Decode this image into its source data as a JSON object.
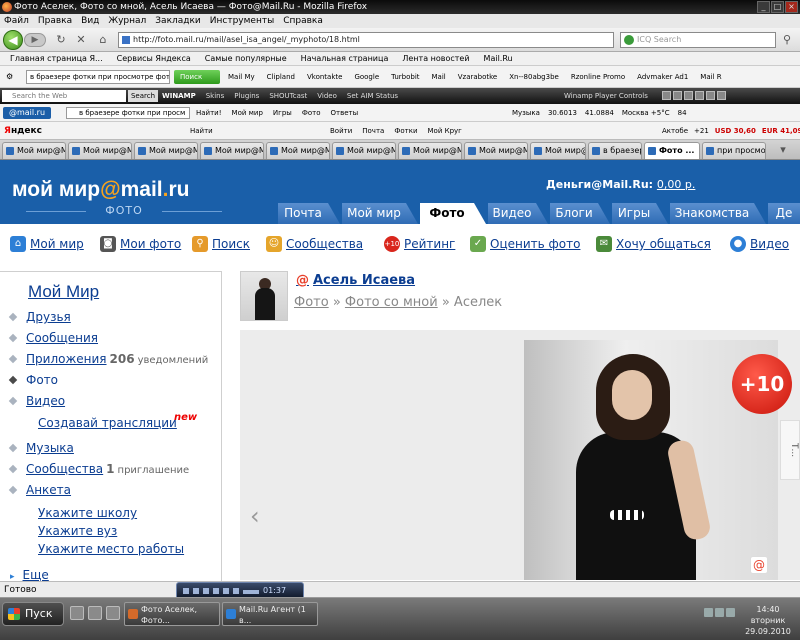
{
  "window": {
    "title": "Фото Аселек, Фото со мной, Асель Исаева — Фото@Mail.Ru - Mozilla Firefox"
  },
  "menu": [
    "Файл",
    "Правка",
    "Вид",
    "Журнал",
    "Закладки",
    "Инструменты",
    "Справка"
  ],
  "nav": {
    "url": "http://foto.mail.ru/mail/asel_isa_angel/_myphoto/18.html",
    "search_placeholder": "ICQ Search"
  },
  "bookmarks": [
    "Главная страница Я...",
    "Сервисы Яндекса",
    "Самые популярные",
    "Начальная страница",
    "Лента новостей",
    "Mail.Ru"
  ],
  "yandex_bar": {
    "combo": "в браезере фотки при просмотре фотогр",
    "search_btn": "Поиск",
    "links": [
      "Mail My",
      "Clipland",
      "Vkontakte",
      "Google",
      "Turbobit",
      "Mail",
      "Vzarabotke",
      "Xn--80abg3be",
      "Rzonline Promo",
      "Advmaker Ad1",
      "Mail R"
    ]
  },
  "winamp_bar": {
    "search_placeholder": "Search the Web",
    "search_btn": "Search",
    "brand": "WINAMP",
    "links": [
      "Skins",
      "Plugins",
      "SHOUTcast",
      "Video",
      "Set AIM Status"
    ],
    "player_controls": "Winamp Player Controls"
  },
  "mail_bar": {
    "logo": "@mail.ru",
    "combo": "в браезере фотки при просм",
    "links": [
      "Найти!",
      "Мой мир",
      "Игры",
      "Фото",
      "Ответы"
    ],
    "right": [
      "Музыка",
      "30.6013",
      "41.0884",
      "Москва +5°C",
      "84"
    ]
  },
  "yandex_bar2": {
    "logo_first": "Я",
    "logo_rest": "ндекс",
    "search": "Найти",
    "links": [
      "Войти",
      "Почта",
      "Фотки",
      "Мой Круг"
    ],
    "right": [
      "Актобе",
      "+21",
      "USD 30,60",
      "EUR 41,09"
    ]
  },
  "tabs": [
    {
      "label": "Мой мир@M..."
    },
    {
      "label": "Мой мир@M..."
    },
    {
      "label": "Мой мир@M..."
    },
    {
      "label": "Мой мир@M..."
    },
    {
      "label": "Мой мир@M..."
    },
    {
      "label": "Мой мир@M..."
    },
    {
      "label": "Мой мир@M..."
    },
    {
      "label": "Мой мир@M..."
    },
    {
      "label": "Мой мир@M..."
    },
    {
      "label": "в браезере ..."
    },
    {
      "label": "Фото ..."
    },
    {
      "label": "при просмо..."
    }
  ],
  "header": {
    "logo_main": "мой мир",
    "logo_at": "@",
    "logo_mail": "mail",
    "logo_dot": ".",
    "logo_ru": "ru",
    "logo_sub": "ФОТО",
    "money_label": "Деньги@Mail.Ru:",
    "money_value": "0,00 р.",
    "tabs": [
      "Почта",
      "Мой мир",
      "Фото",
      "Видео",
      "Блоги",
      "Игры",
      "Знакомства",
      "Де"
    ]
  },
  "subnav": [
    "Мой мир",
    "Мои фото",
    "Поиск",
    "Сообщества",
    "Рейтинг",
    "Оценить фото",
    "Хочу общаться",
    "Видео"
  ],
  "sidebar": {
    "title": "Мой Мир",
    "items": [
      {
        "label": "Друзья"
      },
      {
        "label": "Сообщения"
      },
      {
        "label": "Приложения",
        "count": "206",
        "note": "уведомлений"
      },
      {
        "label": "Фото"
      },
      {
        "label": "Видео"
      },
      {
        "label": "Музыка"
      },
      {
        "label": "Сообщества",
        "count": "1",
        "note": "приглашение"
      },
      {
        "label": "Анкета"
      }
    ],
    "sub_video": "Создавай трансляции",
    "new_tag": "new",
    "sub_anketa": [
      "Укажите школу",
      "Укажите вуз",
      "Укажите место работы"
    ],
    "more": "Еще"
  },
  "profile": {
    "name": "Асель Исаева",
    "crumbs": [
      "Фото",
      "Фото со мной",
      "Аселек"
    ],
    "sep": "»"
  },
  "photo": {
    "plus": "+10",
    "side_tab": "Т..."
  },
  "status": {
    "text": "Готово"
  },
  "media_player": {
    "time": "01:37"
  },
  "taskbar": {
    "start": "Пуск",
    "tasks": [
      "Фото Аселек, Фото...",
      "Mail.Ru Агент (1 в..."
    ],
    "clock_time": "14:40",
    "clock_day": "вторник",
    "clock_date": "29.09.2010"
  },
  "colors": {
    "brand_blue": "#1a5fa9",
    "accent_orange": "#f7a31e",
    "link_blue": "#0b3d91",
    "new_red": "#e00000"
  }
}
